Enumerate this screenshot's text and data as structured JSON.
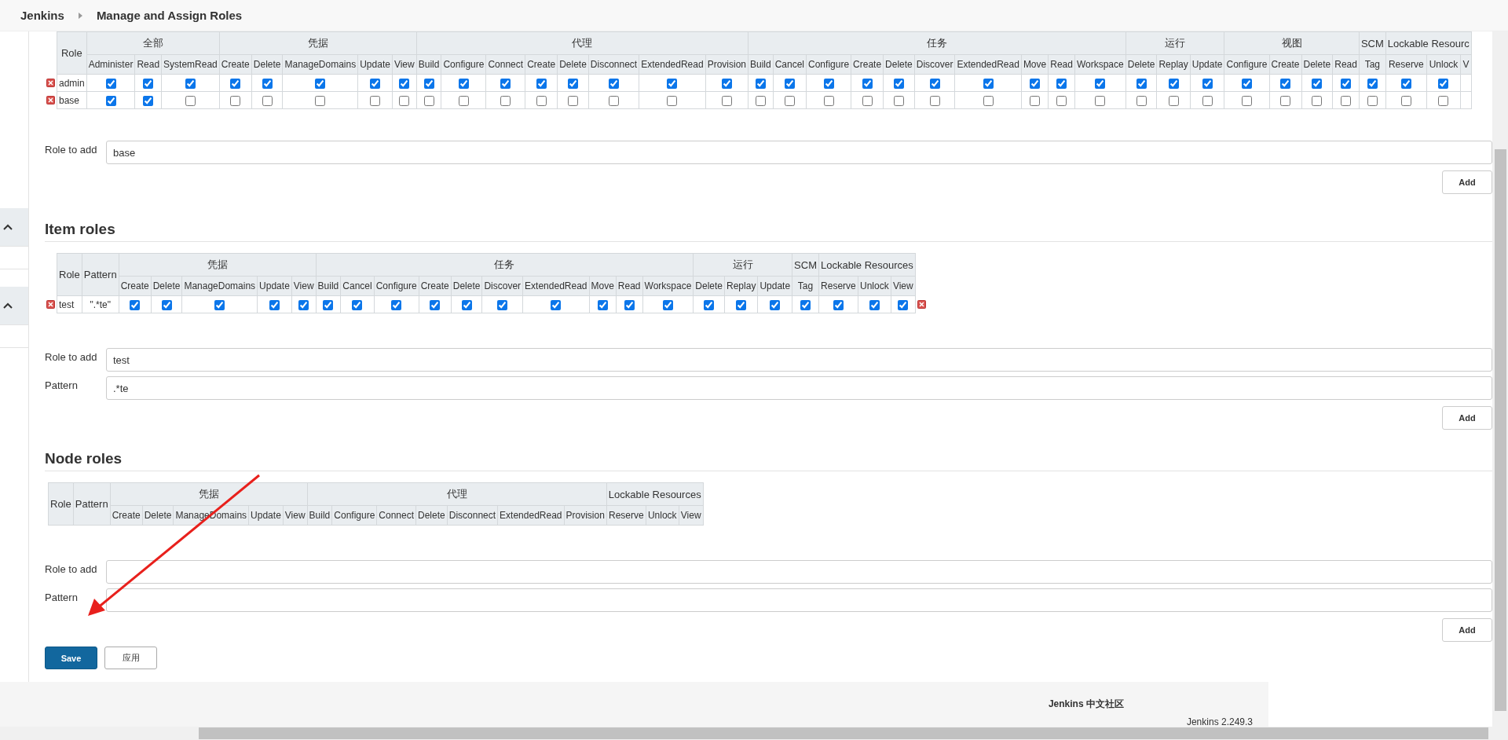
{
  "header": {
    "breadcrumbs": [
      "Jenkins",
      "Manage and Assign Roles"
    ]
  },
  "global_roles": {
    "role_header": "Role",
    "groups": [
      {
        "label": "全部",
        "permissions": [
          "Administer",
          "Read",
          "SystemRead"
        ]
      },
      {
        "label": "凭据",
        "permissions": [
          "Create",
          "Delete",
          "ManageDomains",
          "Update",
          "View"
        ]
      },
      {
        "label": "代理",
        "permissions": [
          "Build",
          "Configure",
          "Connect",
          "Create",
          "Delete",
          "Disconnect",
          "ExtendedRead",
          "Provision"
        ]
      },
      {
        "label": "任务",
        "permissions": [
          "Build",
          "Cancel",
          "Configure",
          "Create",
          "Delete",
          "Discover",
          "ExtendedRead",
          "Move",
          "Read",
          "Workspace"
        ]
      },
      {
        "label": "运行",
        "permissions": [
          "Delete",
          "Replay",
          "Update"
        ]
      },
      {
        "label": "视图",
        "permissions": [
          "Configure",
          "Create",
          "Delete",
          "Read"
        ]
      },
      {
        "label": "SCM",
        "permissions": [
          "Tag"
        ]
      },
      {
        "label": "Lockable Resourc",
        "permissions": [
          "Reserve",
          "Unlock",
          "V"
        ]
      }
    ],
    "rows": [
      {
        "role": "admin",
        "checks": [
          true,
          true,
          true,
          true,
          true,
          true,
          true,
          true,
          true,
          true,
          true,
          true,
          true,
          true,
          true,
          true,
          true,
          true,
          true,
          true,
          true,
          true,
          true,
          true,
          true,
          true,
          true,
          true,
          true,
          true,
          true,
          true,
          true,
          true,
          true,
          true
        ]
      },
      {
        "role": "base",
        "checks": [
          true,
          true,
          false,
          false,
          false,
          false,
          false,
          false,
          false,
          false,
          false,
          false,
          false,
          false,
          false,
          false,
          false,
          false,
          false,
          false,
          false,
          false,
          false,
          false,
          false,
          false,
          false,
          false,
          false,
          false,
          false,
          false,
          false,
          false,
          false,
          false
        ]
      }
    ]
  },
  "global_add": {
    "fields": [
      {
        "label": "Role to add",
        "value": "base"
      }
    ],
    "button": "Add"
  },
  "item_roles": {
    "title": "Item roles",
    "role_header": "Role",
    "pattern_header": "Pattern",
    "groups": [
      {
        "label": "凭据",
        "permissions": [
          "Create",
          "Delete",
          "ManageDomains",
          "Update",
          "View"
        ]
      },
      {
        "label": "任务",
        "permissions": [
          "Build",
          "Cancel",
          "Configure",
          "Create",
          "Delete",
          "Discover",
          "ExtendedRead",
          "Move",
          "Read",
          "Workspace"
        ]
      },
      {
        "label": "运行",
        "permissions": [
          "Delete",
          "Replay",
          "Update"
        ]
      },
      {
        "label": "SCM",
        "permissions": [
          "Tag"
        ]
      },
      {
        "label": "Lockable Resources",
        "permissions": [
          "Reserve",
          "Unlock",
          "View"
        ]
      }
    ],
    "rows": [
      {
        "role": "test",
        "pattern": "\".*te\"",
        "checks": [
          true,
          true,
          true,
          true,
          true,
          true,
          true,
          true,
          true,
          true,
          true,
          true,
          true,
          true,
          true,
          true,
          true,
          true,
          true,
          true,
          true,
          true
        ]
      }
    ]
  },
  "item_add": {
    "fields": [
      {
        "label": "Role to add",
        "value": "test"
      },
      {
        "label": "Pattern",
        "value": ".*te"
      }
    ],
    "button": "Add"
  },
  "node_roles": {
    "title": "Node roles",
    "role_header": "Role",
    "pattern_header": "Pattern",
    "groups": [
      {
        "label": "凭据",
        "permissions": [
          "Create",
          "Delete",
          "ManageDomains",
          "Update",
          "View"
        ]
      },
      {
        "label": "代理",
        "permissions": [
          "Build",
          "Configure",
          "Connect",
          "Delete",
          "Disconnect",
          "ExtendedRead",
          "Provision"
        ]
      },
      {
        "label": "Lockable Resources",
        "permissions": [
          "Reserve",
          "Unlock",
          "View"
        ]
      }
    ]
  },
  "node_add": {
    "fields": [
      {
        "label": "Role to add"
      },
      {
        "label": "Pattern"
      }
    ],
    "button": "Add"
  },
  "actions": {
    "save": "Save",
    "apply": "应用"
  },
  "footer": {
    "community": "Jenkins 中文社区",
    "version": "Jenkins 2.249.3"
  }
}
